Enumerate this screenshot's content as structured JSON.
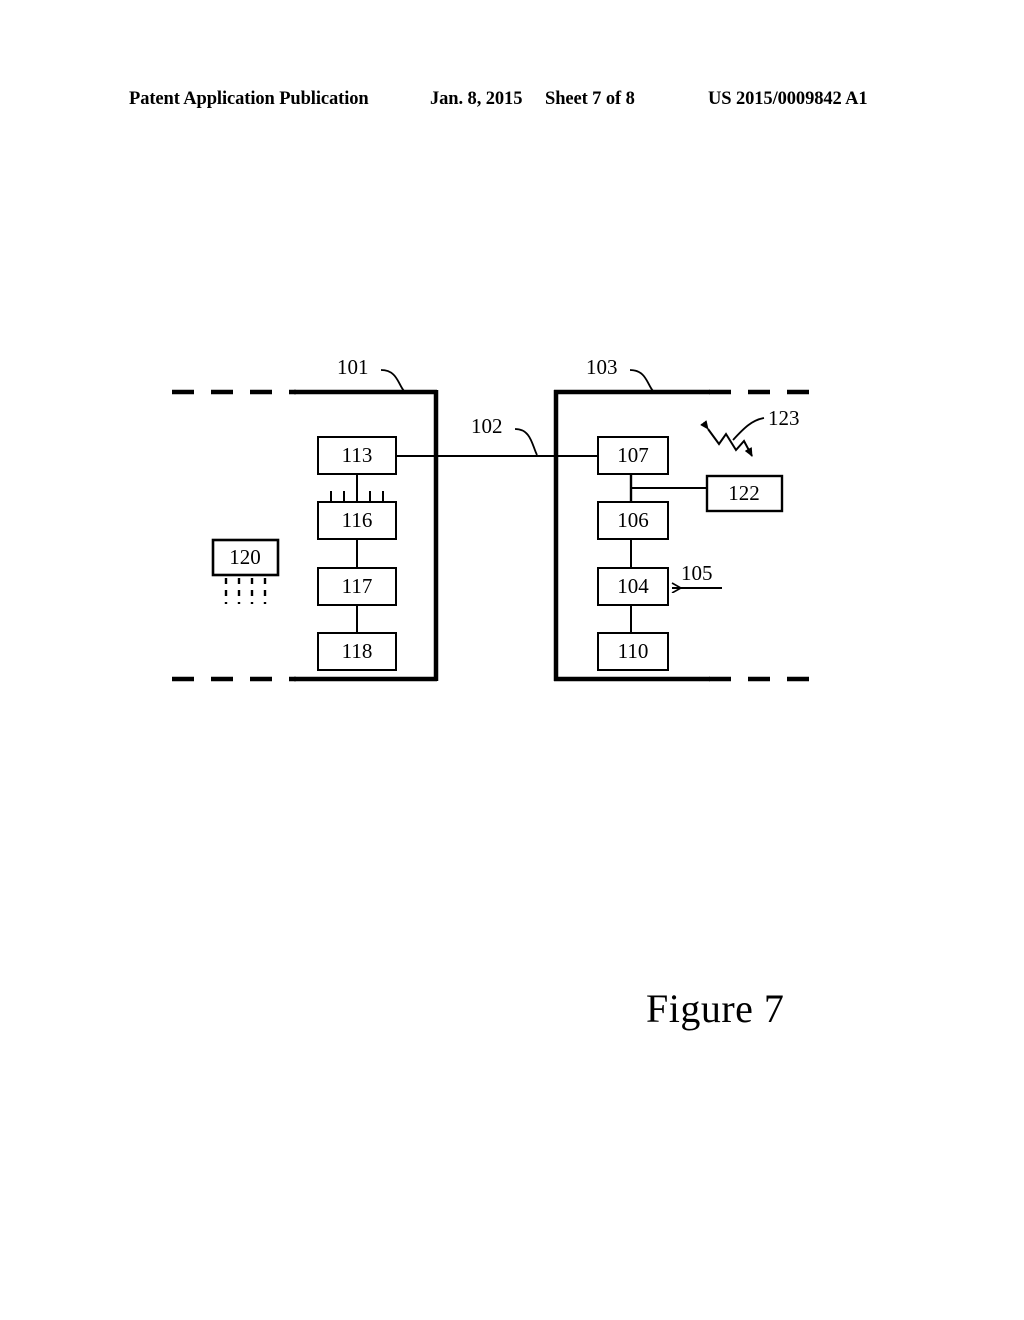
{
  "header": {
    "publication": "Patent Application Publication",
    "date": "Jan. 8, 2015",
    "sheet": "Sheet 7 of 8",
    "patent_number": "US 2015/0009842 A1"
  },
  "figure": {
    "caption": "Figure 7",
    "ink_color": "#000000",
    "background": "#ffffff"
  },
  "diagram": {
    "type": "block-diagram",
    "left_enclosure": {
      "ref": "101",
      "boxes": [
        {
          "ref": "113"
        },
        {
          "ref": "116"
        },
        {
          "ref": "117"
        },
        {
          "ref": "118"
        }
      ]
    },
    "right_enclosure": {
      "ref": "103",
      "boxes": [
        {
          "ref": "107"
        },
        {
          "ref": "106"
        },
        {
          "ref": "104"
        },
        {
          "ref": "110"
        },
        {
          "ref": "122"
        }
      ]
    },
    "external_boxes": [
      {
        "ref": "120"
      }
    ],
    "link": {
      "ref": "102"
    },
    "input_arrow": {
      "ref": "105"
    },
    "wireless_symbol": {
      "ref": "123"
    }
  }
}
